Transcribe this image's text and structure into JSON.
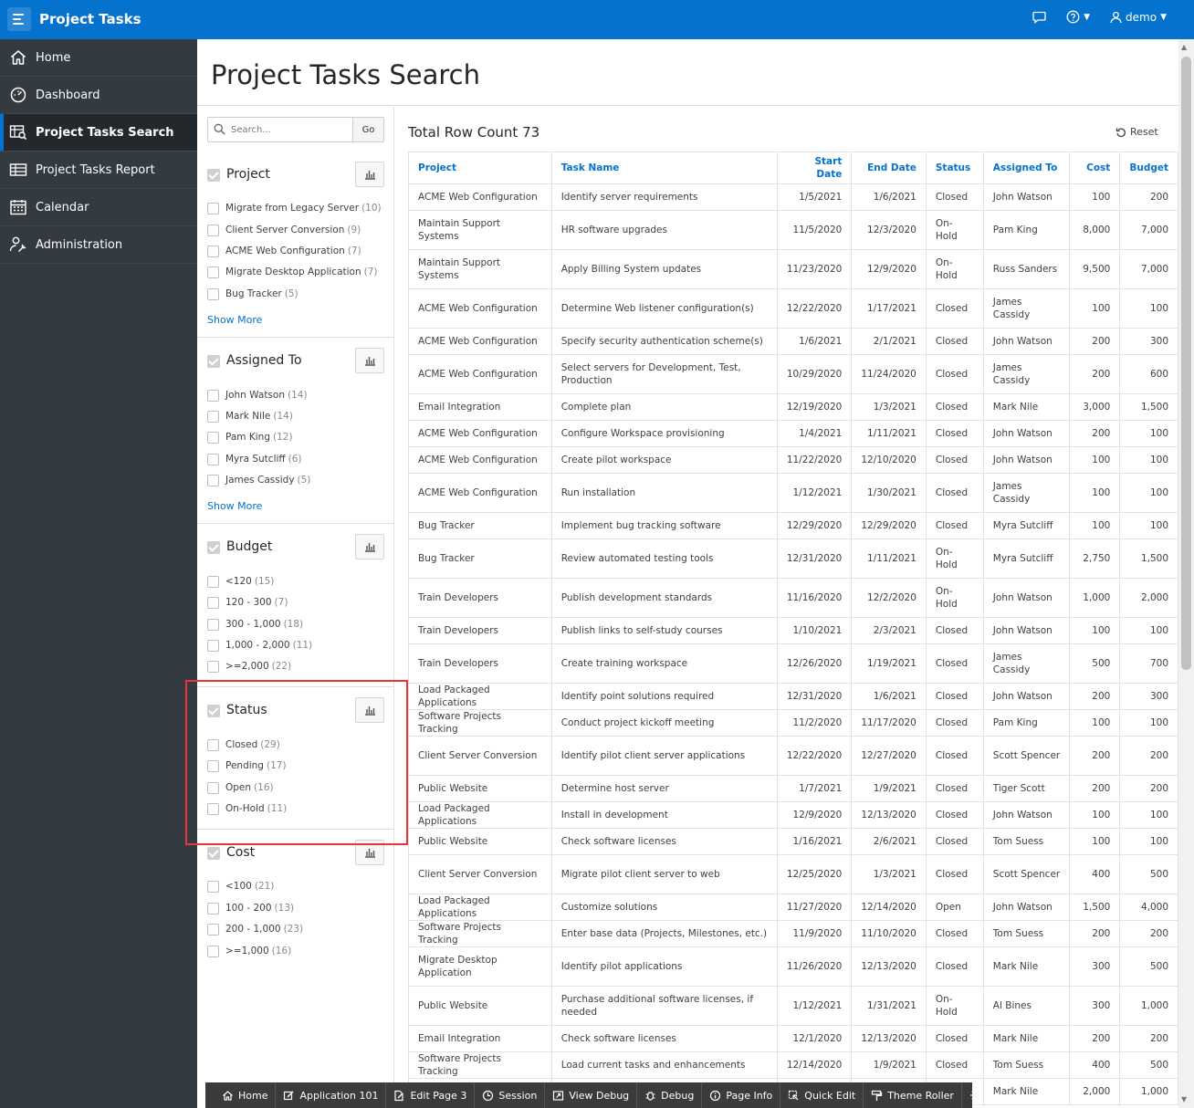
{
  "header": {
    "app_title": "Project Tasks",
    "user": "demo"
  },
  "sidebar": {
    "items": [
      {
        "label": "Home",
        "icon": "home-icon"
      },
      {
        "label": "Dashboard",
        "icon": "dashboard-icon"
      },
      {
        "label": "Project Tasks Search",
        "icon": "search-report-icon",
        "active": true
      },
      {
        "label": "Project Tasks Report",
        "icon": "table-icon"
      },
      {
        "label": "Calendar",
        "icon": "calendar-icon"
      },
      {
        "label": "Administration",
        "icon": "user-wrench-icon"
      }
    ]
  },
  "page": {
    "title": "Project Tasks Search"
  },
  "search": {
    "placeholder": "Search...",
    "go_label": "Go"
  },
  "facets": {
    "project": {
      "title": "Project",
      "options": [
        {
          "label": "Migrate from Legacy Server",
          "count": "(10)"
        },
        {
          "label": "Client Server Conversion",
          "count": "(9)"
        },
        {
          "label": "ACME Web Configuration",
          "count": "(7)"
        },
        {
          "label": "Migrate Desktop Application",
          "count": "(7)"
        },
        {
          "label": "Bug Tracker",
          "count": "(5)"
        }
      ],
      "show_more": "Show More"
    },
    "assigned_to": {
      "title": "Assigned To",
      "options": [
        {
          "label": "John Watson",
          "count": "(14)"
        },
        {
          "label": "Mark Nile",
          "count": "(14)"
        },
        {
          "label": "Pam King",
          "count": "(12)"
        },
        {
          "label": "Myra Sutcliff",
          "count": "(6)"
        },
        {
          "label": "James Cassidy",
          "count": "(5)"
        }
      ],
      "show_more": "Show More"
    },
    "budget": {
      "title": "Budget",
      "options": [
        {
          "label": "<120",
          "count": "(15)"
        },
        {
          "label": "120 - 300",
          "count": "(7)"
        },
        {
          "label": "300 - 1,000",
          "count": "(18)"
        },
        {
          "label": "1,000 - 2,000",
          "count": "(11)"
        },
        {
          "label": ">=2,000",
          "count": "(22)"
        }
      ]
    },
    "status": {
      "title": "Status",
      "options": [
        {
          "label": "Closed",
          "count": "(29)"
        },
        {
          "label": "Pending",
          "count": "(17)"
        },
        {
          "label": "Open",
          "count": "(16)"
        },
        {
          "label": "On-Hold",
          "count": "(11)"
        }
      ]
    },
    "cost": {
      "title": "Cost",
      "options": [
        {
          "label": "<100",
          "count": "(21)"
        },
        {
          "label": "100 - 200",
          "count": "(13)"
        },
        {
          "label": "200 - 1,000",
          "count": "(23)"
        },
        {
          "label": ">=1,000",
          "count": "(16)"
        }
      ]
    }
  },
  "results": {
    "row_count_label": "Total Row Count 73",
    "reset_label": "Reset",
    "columns": [
      "Project",
      "Task Name",
      "Start Date",
      "End Date",
      "Status",
      "Assigned To",
      "Cost",
      "Budget"
    ],
    "rows": [
      [
        "ACME Web Configuration",
        "Identify server requirements",
        "1/5/2021",
        "1/6/2021",
        "Closed",
        "John Watson",
        "100",
        "200"
      ],
      [
        "Maintain Support Systems",
        "HR software upgrades",
        "11/5/2020",
        "12/3/2020",
        "On-Hold",
        "Pam King",
        "8,000",
        "7,000"
      ],
      [
        "Maintain Support Systems",
        "Apply Billing System updates",
        "11/23/2020",
        "12/9/2020",
        "On-Hold",
        "Russ Sanders",
        "9,500",
        "7,000"
      ],
      [
        "ACME Web Configuration",
        "Determine Web listener configuration(s)",
        "12/22/2020",
        "1/17/2021",
        "Closed",
        "James Cassidy",
        "100",
        "100"
      ],
      [
        "ACME Web Configuration",
        "Specify security authentication scheme(s)",
        "1/6/2021",
        "2/1/2021",
        "Closed",
        "John Watson",
        "200",
        "300"
      ],
      [
        "ACME Web Configuration",
        "Select servers for Development, Test, Production",
        "10/29/2020",
        "11/24/2020",
        "Closed",
        "James Cassidy",
        "200",
        "600"
      ],
      [
        "Email Integration",
        "Complete plan",
        "12/19/2020",
        "1/3/2021",
        "Closed",
        "Mark Nile",
        "3,000",
        "1,500"
      ],
      [
        "ACME Web Configuration",
        "Configure Workspace provisioning",
        "1/4/2021",
        "1/11/2021",
        "Closed",
        "John Watson",
        "200",
        "100"
      ],
      [
        "ACME Web Configuration",
        "Create pilot workspace",
        "11/22/2020",
        "12/10/2020",
        "Closed",
        "John Watson",
        "100",
        "100"
      ],
      [
        "ACME Web Configuration",
        "Run installation",
        "1/12/2021",
        "1/30/2021",
        "Closed",
        "James Cassidy",
        "100",
        "100"
      ],
      [
        "Bug Tracker",
        "Implement bug tracking software",
        "12/29/2020",
        "12/29/2020",
        "Closed",
        "Myra Sutcliff",
        "100",
        "100"
      ],
      [
        "Bug Tracker",
        "Review automated testing tools",
        "12/31/2020",
        "1/11/2021",
        "On-Hold",
        "Myra Sutcliff",
        "2,750",
        "1,500"
      ],
      [
        "Train Developers",
        "Publish development standards",
        "11/16/2020",
        "12/2/2020",
        "On-Hold",
        "John Watson",
        "1,000",
        "2,000"
      ],
      [
        "Train Developers",
        "Publish links to self-study courses",
        "1/10/2021",
        "2/3/2021",
        "Closed",
        "John Watson",
        "100",
        "100"
      ],
      [
        "Train Developers",
        "Create training workspace",
        "12/26/2020",
        "1/19/2021",
        "Closed",
        "James Cassidy",
        "500",
        "700"
      ],
      [
        "Load Packaged Applications",
        "Identify point solutions required",
        "12/31/2020",
        "1/6/2021",
        "Closed",
        "John Watson",
        "200",
        "300"
      ],
      [
        "Software Projects Tracking",
        "Conduct project kickoff meeting",
        "11/2/2020",
        "11/17/2020",
        "Closed",
        "Pam King",
        "100",
        "100"
      ],
      [
        "Client Server Conversion",
        "Identify pilot client server applications",
        "12/22/2020",
        "12/27/2020",
        "Closed",
        "Scott Spencer",
        "200",
        "200"
      ],
      [
        "Public Website",
        "Determine host server",
        "1/7/2021",
        "1/9/2021",
        "Closed",
        "Tiger Scott",
        "200",
        "200"
      ],
      [
        "Load Packaged Applications",
        "Install in development",
        "12/9/2020",
        "12/13/2020",
        "Closed",
        "John Watson",
        "100",
        "100"
      ],
      [
        "Public Website",
        "Check software licenses",
        "1/16/2021",
        "2/6/2021",
        "Closed",
        "Tom Suess",
        "100",
        "100"
      ],
      [
        "Client Server Conversion",
        "Migrate pilot client server to web",
        "12/25/2020",
        "1/3/2021",
        "Closed",
        "Scott Spencer",
        "400",
        "500"
      ],
      [
        "Load Packaged Applications",
        "Customize solutions",
        "11/27/2020",
        "12/14/2020",
        "Open",
        "John Watson",
        "1,500",
        "4,000"
      ],
      [
        "Software Projects Tracking",
        "Enter base data (Projects, Milestones, etc.)",
        "11/9/2020",
        "11/10/2020",
        "Closed",
        "Tom Suess",
        "200",
        "200"
      ],
      [
        "Migrate Desktop Application",
        "Identify pilot applications",
        "11/26/2020",
        "12/13/2020",
        "Closed",
        "Mark Nile",
        "300",
        "500"
      ],
      [
        "Public Website",
        "Purchase additional software licenses, if needed",
        "1/12/2021",
        "1/31/2021",
        "On-Hold",
        "Al Bines",
        "300",
        "1,000"
      ],
      [
        "Email Integration",
        "Check software licenses",
        "12/1/2020",
        "12/13/2020",
        "Closed",
        "Mark Nile",
        "200",
        "200"
      ],
      [
        "Software Projects Tracking",
        "Load current tasks and enhancements",
        "12/14/2020",
        "1/9/2021",
        "Closed",
        "Tom Suess",
        "400",
        "500"
      ],
      [
        "",
        "",
        "",
        "",
        "",
        "Mark Nile",
        "2,000",
        "1,000"
      ]
    ]
  },
  "devbar": {
    "items": [
      {
        "label": "Home",
        "icon": "home-icon"
      },
      {
        "label": "Application 101",
        "icon": "edit-icon"
      },
      {
        "label": "Edit Page 3",
        "icon": "edit-page-icon"
      },
      {
        "label": "Session",
        "icon": "session-icon"
      },
      {
        "label": "View Debug",
        "icon": "view-debug-icon"
      },
      {
        "label": "Debug",
        "icon": "debug-icon"
      },
      {
        "label": "Page Info",
        "icon": "info-icon"
      },
      {
        "label": "Quick Edit",
        "icon": "quick-edit-icon"
      },
      {
        "label": "Theme Roller",
        "icon": "paint-roller-icon"
      }
    ]
  }
}
